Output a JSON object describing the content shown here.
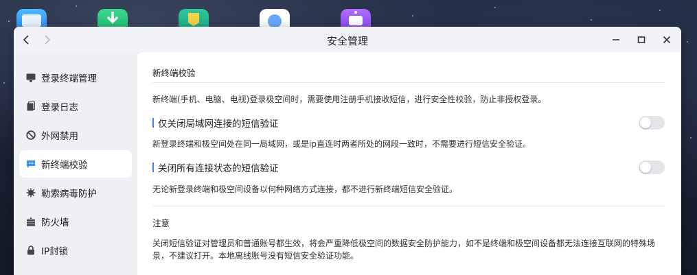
{
  "window": {
    "title": "安全管理",
    "back_icon": "chevron-left-icon",
    "forward_icon": "chevron-right-icon",
    "controls": [
      "minimize-icon",
      "maximize-icon",
      "close-icon"
    ]
  },
  "sidebar": {
    "items": [
      {
        "label": "登录终端管理",
        "icon": "monitor-icon",
        "active": false
      },
      {
        "label": "登录日志",
        "icon": "log-icon",
        "active": false
      },
      {
        "label": "外网禁用",
        "icon": "ban-icon",
        "active": false
      },
      {
        "label": "新终端校验",
        "icon": "message-icon",
        "active": true
      },
      {
        "label": "勒索病毒防护",
        "icon": "virus-shield-icon",
        "active": false
      },
      {
        "label": "防火墙",
        "icon": "firewall-icon",
        "active": false
      },
      {
        "label": "IP封锁",
        "icon": "lock-icon",
        "active": false
      }
    ]
  },
  "main": {
    "section_title": "新终端校验",
    "intro": "新终端(手机、电脑、电视)登录极空间时，需要使用注册手机接收短信，进行安全性校验，防止非授权登录。",
    "settings": [
      {
        "label": "仅关闭局域网连接的短信验证",
        "enabled": false,
        "desc": "新登录终端和极空间处在同一局域网，或是ip直连时两者所处的网段一致时，不需要进行短信安全验证。"
      },
      {
        "label": "关闭所有连接状态的短信验证",
        "enabled": false,
        "desc": "无论新登录终端和极空间设备以何种网络方式连接，都不进行新终端短信安全验证。"
      }
    ],
    "note_title": "注意",
    "note_text": "关闭短信验证对管理员和普通账号都生效，将会严重降低极空间的数据安全防护能力，如不是终端和极空间设备都无法连接互联网的特殊场景，不建议打开。本地离线账号没有短信安全验证功能。"
  },
  "colors": {
    "accent": "#4a7cf7",
    "toggle_off": "#e4e5e8",
    "sidebar_bg": "#eef0f3",
    "content_bg": "#ffffff"
  }
}
